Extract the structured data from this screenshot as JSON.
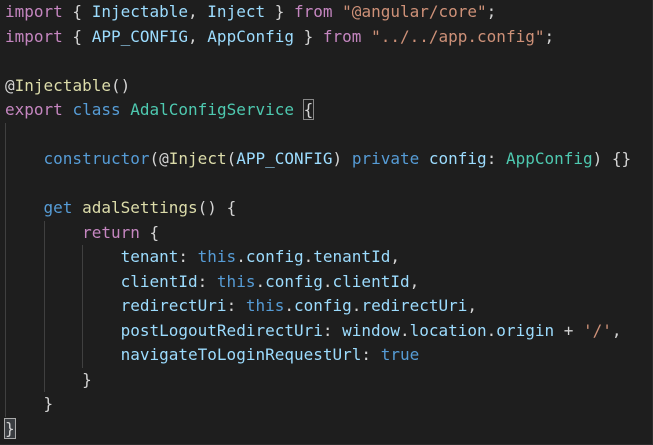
{
  "editor": {
    "language": "typescript",
    "theme_colors": {
      "background": "#1e1e1e",
      "keyword": "#c586c0",
      "storage": "#569cd6",
      "type": "#4ec9b0",
      "function": "#dcdcaa",
      "variable": "#9cdcfe",
      "string": "#ce9178",
      "text": "#d4d4d4"
    },
    "lines": [
      [
        {
          "t": "import",
          "c": "kw"
        },
        {
          "t": " { ",
          "c": "punc"
        },
        {
          "t": "Injectable",
          "c": "var"
        },
        {
          "t": ", ",
          "c": "punc"
        },
        {
          "t": "Inject",
          "c": "var"
        },
        {
          "t": " } ",
          "c": "punc"
        },
        {
          "t": "from",
          "c": "kw"
        },
        {
          "t": " ",
          "c": "punc"
        },
        {
          "t": "\"@angular/core\"",
          "c": "str"
        },
        {
          "t": ";",
          "c": "punc"
        }
      ],
      [
        {
          "t": "import",
          "c": "kw"
        },
        {
          "t": " { ",
          "c": "punc"
        },
        {
          "t": "APP_CONFIG",
          "c": "var"
        },
        {
          "t": ", ",
          "c": "punc"
        },
        {
          "t": "AppConfig",
          "c": "var"
        },
        {
          "t": " } ",
          "c": "punc"
        },
        {
          "t": "from",
          "c": "kw"
        },
        {
          "t": " ",
          "c": "punc"
        },
        {
          "t": "\"../../app.config\"",
          "c": "str"
        },
        {
          "t": ";",
          "c": "punc"
        }
      ],
      [],
      [
        {
          "t": "@",
          "c": "dec"
        },
        {
          "t": "Injectable",
          "c": "fn"
        },
        {
          "t": "()",
          "c": "punc"
        }
      ],
      [
        {
          "t": "export",
          "c": "kw"
        },
        {
          "t": " ",
          "c": "punc"
        },
        {
          "t": "class",
          "c": "storage"
        },
        {
          "t": " ",
          "c": "punc"
        },
        {
          "t": "AdalConfigService",
          "c": "type"
        },
        {
          "t": " ",
          "c": "punc"
        },
        {
          "t": "{",
          "c": "punc",
          "m": "match"
        }
      ],
      [],
      [
        {
          "t": "    ",
          "c": "punc"
        },
        {
          "t": "constructor",
          "c": "storage"
        },
        {
          "t": "(",
          "c": "punc"
        },
        {
          "t": "@",
          "c": "dec"
        },
        {
          "t": "Inject",
          "c": "fn"
        },
        {
          "t": "(",
          "c": "punc"
        },
        {
          "t": "APP_CONFIG",
          "c": "var"
        },
        {
          "t": ") ",
          "c": "punc"
        },
        {
          "t": "private",
          "c": "storage"
        },
        {
          "t": " ",
          "c": "punc"
        },
        {
          "t": "config",
          "c": "var"
        },
        {
          "t": ": ",
          "c": "punc"
        },
        {
          "t": "AppConfig",
          "c": "type"
        },
        {
          "t": ") {}",
          "c": "punc"
        }
      ],
      [],
      [
        {
          "t": "    ",
          "c": "punc"
        },
        {
          "t": "get",
          "c": "storage"
        },
        {
          "t": " ",
          "c": "punc"
        },
        {
          "t": "adalSettings",
          "c": "fn"
        },
        {
          "t": "() {",
          "c": "punc"
        }
      ],
      [
        {
          "t": "        ",
          "c": "punc"
        },
        {
          "t": "return",
          "c": "kw"
        },
        {
          "t": " {",
          "c": "punc"
        }
      ],
      [
        {
          "t": "            ",
          "c": "punc"
        },
        {
          "t": "tenant",
          "c": "var"
        },
        {
          "t": ": ",
          "c": "punc"
        },
        {
          "t": "this",
          "c": "storage"
        },
        {
          "t": ".",
          "c": "punc"
        },
        {
          "t": "config",
          "c": "var"
        },
        {
          "t": ".",
          "c": "punc"
        },
        {
          "t": "tenantId",
          "c": "var"
        },
        {
          "t": ",",
          "c": "punc"
        }
      ],
      [
        {
          "t": "            ",
          "c": "punc"
        },
        {
          "t": "clientId",
          "c": "var"
        },
        {
          "t": ": ",
          "c": "punc"
        },
        {
          "t": "this",
          "c": "storage"
        },
        {
          "t": ".",
          "c": "punc"
        },
        {
          "t": "config",
          "c": "var"
        },
        {
          "t": ".",
          "c": "punc"
        },
        {
          "t": "clientId",
          "c": "var"
        },
        {
          "t": ",",
          "c": "punc"
        }
      ],
      [
        {
          "t": "            ",
          "c": "punc"
        },
        {
          "t": "redirectUri",
          "c": "var"
        },
        {
          "t": ": ",
          "c": "punc"
        },
        {
          "t": "this",
          "c": "storage"
        },
        {
          "t": ".",
          "c": "punc"
        },
        {
          "t": "config",
          "c": "var"
        },
        {
          "t": ".",
          "c": "punc"
        },
        {
          "t": "redirectUri",
          "c": "var"
        },
        {
          "t": ",",
          "c": "punc"
        }
      ],
      [
        {
          "t": "            ",
          "c": "punc"
        },
        {
          "t": "postLogoutRedirectUri",
          "c": "var"
        },
        {
          "t": ": ",
          "c": "punc"
        },
        {
          "t": "window",
          "c": "var"
        },
        {
          "t": ".",
          "c": "punc"
        },
        {
          "t": "location",
          "c": "var"
        },
        {
          "t": ".",
          "c": "punc"
        },
        {
          "t": "origin",
          "c": "var"
        },
        {
          "t": " + ",
          "c": "punc"
        },
        {
          "t": "'/'",
          "c": "str"
        },
        {
          "t": ",",
          "c": "punc"
        }
      ],
      [
        {
          "t": "            ",
          "c": "punc"
        },
        {
          "t": "navigateToLoginRequestUrl",
          "c": "var"
        },
        {
          "t": ": ",
          "c": "punc"
        },
        {
          "t": "true",
          "c": "storage"
        }
      ],
      [
        {
          "t": "        ",
          "c": "punc"
        },
        {
          "t": "}",
          "c": "punc"
        }
      ],
      [
        {
          "t": "    ",
          "c": "punc"
        },
        {
          "t": "}",
          "c": "punc"
        }
      ],
      [
        {
          "t": "}",
          "c": "punc",
          "m": "cursor"
        }
      ]
    ]
  }
}
